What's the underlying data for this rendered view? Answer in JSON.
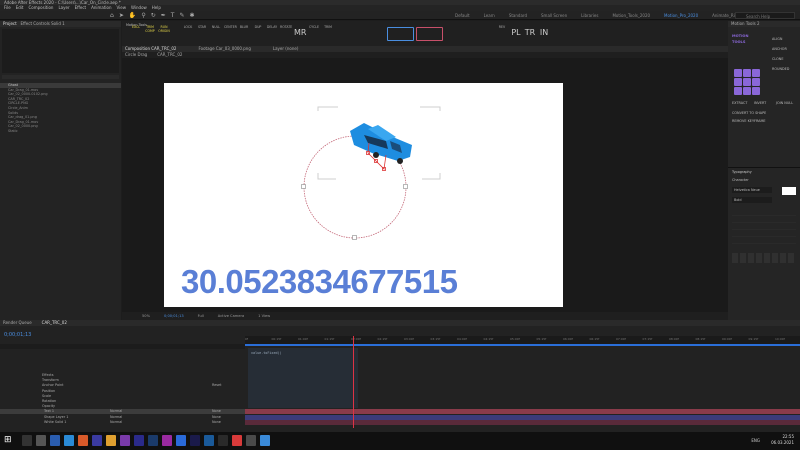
{
  "window_title": "Adobe After Effects 2020 - C:\\Users\\...\\Car_On_Circle.aep *",
  "menu": [
    "File",
    "Edit",
    "Composition",
    "Layer",
    "Effect",
    "Animation",
    "View",
    "Window",
    "Help"
  ],
  "workspaces": [
    "Default",
    "Learn",
    "Standard",
    "Small Screen",
    "Libraries",
    "Motion_Tools_2020",
    "Motion_Pro_2020",
    "Animate_Rigging"
  ],
  "active_workspace": "Motion_Pro_2020",
  "search_placeholder": "Search Help",
  "project": {
    "tab": "Project",
    "effects_tab": "Effect Controls Solid 1",
    "items": [
      "Ghost",
      "Car_Drag_01.mov",
      "Car_02_0000-0102.png",
      "CAR_TRC_02",
      "CIRCLE.PNG",
      "Circle_Anim",
      "Solids",
      "Car_drag_01.png",
      "Car_Drag_01.mov",
      "Car_02_0000.png",
      "Static"
    ],
    "selected_index": 0
  },
  "plugin_bar": {
    "label": "Motion Tools",
    "buttons": [
      "EXCL",
      "TRIM COMP",
      "RUN ORIGIN",
      "LOCK",
      "STAR",
      "NULL",
      "CENTER",
      "BLUR",
      "DUP",
      "DELAY",
      "ROTATE",
      "MR",
      "CYCLE",
      "TRIM",
      "REV",
      "PL",
      "TR",
      "IN"
    ]
  },
  "viewer": {
    "tabs": [
      "Composition CAR_TRC_02",
      "Footage Car_03_0000.png",
      "Layer (none)"
    ],
    "breadcrumb": [
      "Circle Drag",
      "CAR_TRC_02"
    ],
    "zoom": "50%",
    "time": "0;00;01;13",
    "resolution": "Full",
    "camera": "Active Camera",
    "views": "1 View",
    "value_display": "30.0523834677515"
  },
  "right_panel": {
    "title": "Motion Tools 2",
    "sections": [
      "ALIGN",
      "ANCHOR",
      "CLONE",
      "ROUNDED",
      "EXTRACT",
      "INVERT",
      "JOIN NULL",
      "CONVERT TO SHAPE",
      "REMOVE KEYFRAME"
    ],
    "typography_title": "Typography",
    "character_title": "Character",
    "font": "Helvetica Neue",
    "style": "Bold"
  },
  "timeline": {
    "comp_tab": "CAR_TRC_02",
    "render_tab": "Render Queue",
    "timecode": "0;00;01;13",
    "ruler_ticks": [
      "0f",
      "00:15f",
      "01:00f",
      "01:15f",
      "02:00f",
      "02:15f",
      "03:00f",
      "03:15f",
      "04:00f",
      "04:15f",
      "05:00f",
      "05:15f",
      "06:00f",
      "06:15f",
      "07:00f",
      "07:15f",
      "08:00f",
      "08:15f",
      "09:00f",
      "09:15f",
      "10:00f"
    ],
    "expression": "value.toFixed()",
    "layers": [
      {
        "name": "Effects",
        "mode": "",
        "parent": ""
      },
      {
        "name": "Transform",
        "mode": "",
        "parent": ""
      },
      {
        "name": "Anchor Point",
        "mode": "",
        "parent": "Reset"
      },
      {
        "name": "Position",
        "mode": "",
        "parent": ""
      },
      {
        "name": "Scale",
        "mode": "",
        "parent": ""
      },
      {
        "name": "Rotation",
        "mode": "",
        "parent": ""
      },
      {
        "name": "Opacity",
        "mode": "",
        "parent": ""
      },
      {
        "name": "Text 1",
        "mode": "Normal",
        "parent": "None"
      },
      {
        "name": "Shape Layer 1",
        "mode": "Normal",
        "parent": "None"
      },
      {
        "name": "White Solid 1",
        "mode": "Normal",
        "parent": "None"
      }
    ]
  },
  "taskbar": {
    "time": "22:55",
    "date": "06.03.2021",
    "lang": "ENG"
  }
}
